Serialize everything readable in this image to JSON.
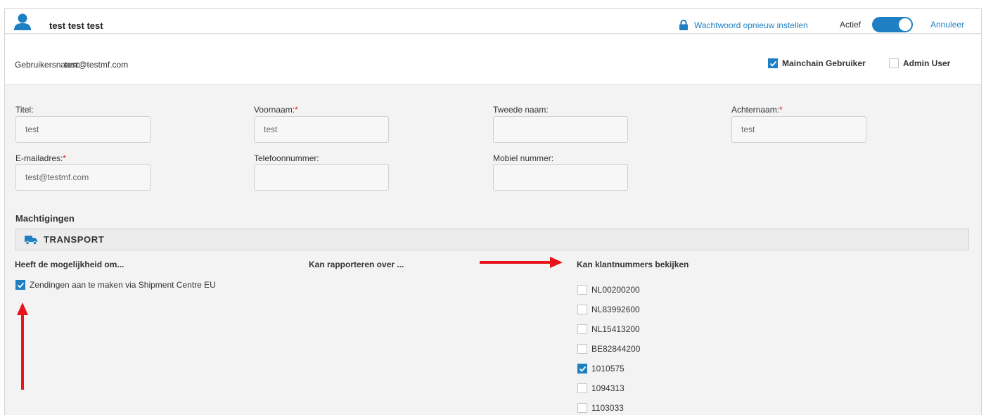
{
  "header": {
    "username": "test test test",
    "reset_password": "Wachtwoord opnieuw instellen",
    "active_label": "Actief",
    "active_on": true,
    "cancel": "Annuleer",
    "accent": "#1f7fc3"
  },
  "subheader": {
    "label": "Gebruikersnaam:",
    "value": "test@testmf.com",
    "mainchain_user": "Mainchain Gebruiker",
    "mainchain_checked": true,
    "admin_user": "Admin User",
    "admin_checked": false
  },
  "form": {
    "titel": {
      "label": "Titel:",
      "value": "test"
    },
    "voornaam": {
      "label": "Voornaam:",
      "value": "test",
      "required": "*"
    },
    "tweede_naam": {
      "label": "Tweede naam:",
      "value": ""
    },
    "achternaam": {
      "label": "Achternaam:",
      "value": "test",
      "required": "*"
    },
    "email": {
      "label": "E-mailadres:",
      "value": "test@testmf.com",
      "required": "*"
    },
    "telefoon": {
      "label": "Telefoonnummer:",
      "value": ""
    },
    "mobiel": {
      "label": "Mobiel nummer:",
      "value": ""
    }
  },
  "permissions": {
    "title": "Machtigingen",
    "category": "TRANSPORT",
    "col1_header": "Heeft de mogelijkheid om...",
    "col2_header": "Kan rapporteren over ...",
    "col3_header": "Kan klantnummers bekijken",
    "abilities": [
      {
        "label": "Zendingen aan te maken via Shipment Centre EU",
        "checked": true
      }
    ],
    "customer_numbers": [
      {
        "label": "NL00200200",
        "checked": false
      },
      {
        "label": "NL83992600",
        "checked": false
      },
      {
        "label": "NL15413200",
        "checked": false
      },
      {
        "label": "BE82844200",
        "checked": false
      },
      {
        "label": "1010575",
        "checked": true
      },
      {
        "label": "1094313",
        "checked": false
      },
      {
        "label": "1103033",
        "checked": false
      }
    ]
  },
  "annotation_color": "#e8141c"
}
